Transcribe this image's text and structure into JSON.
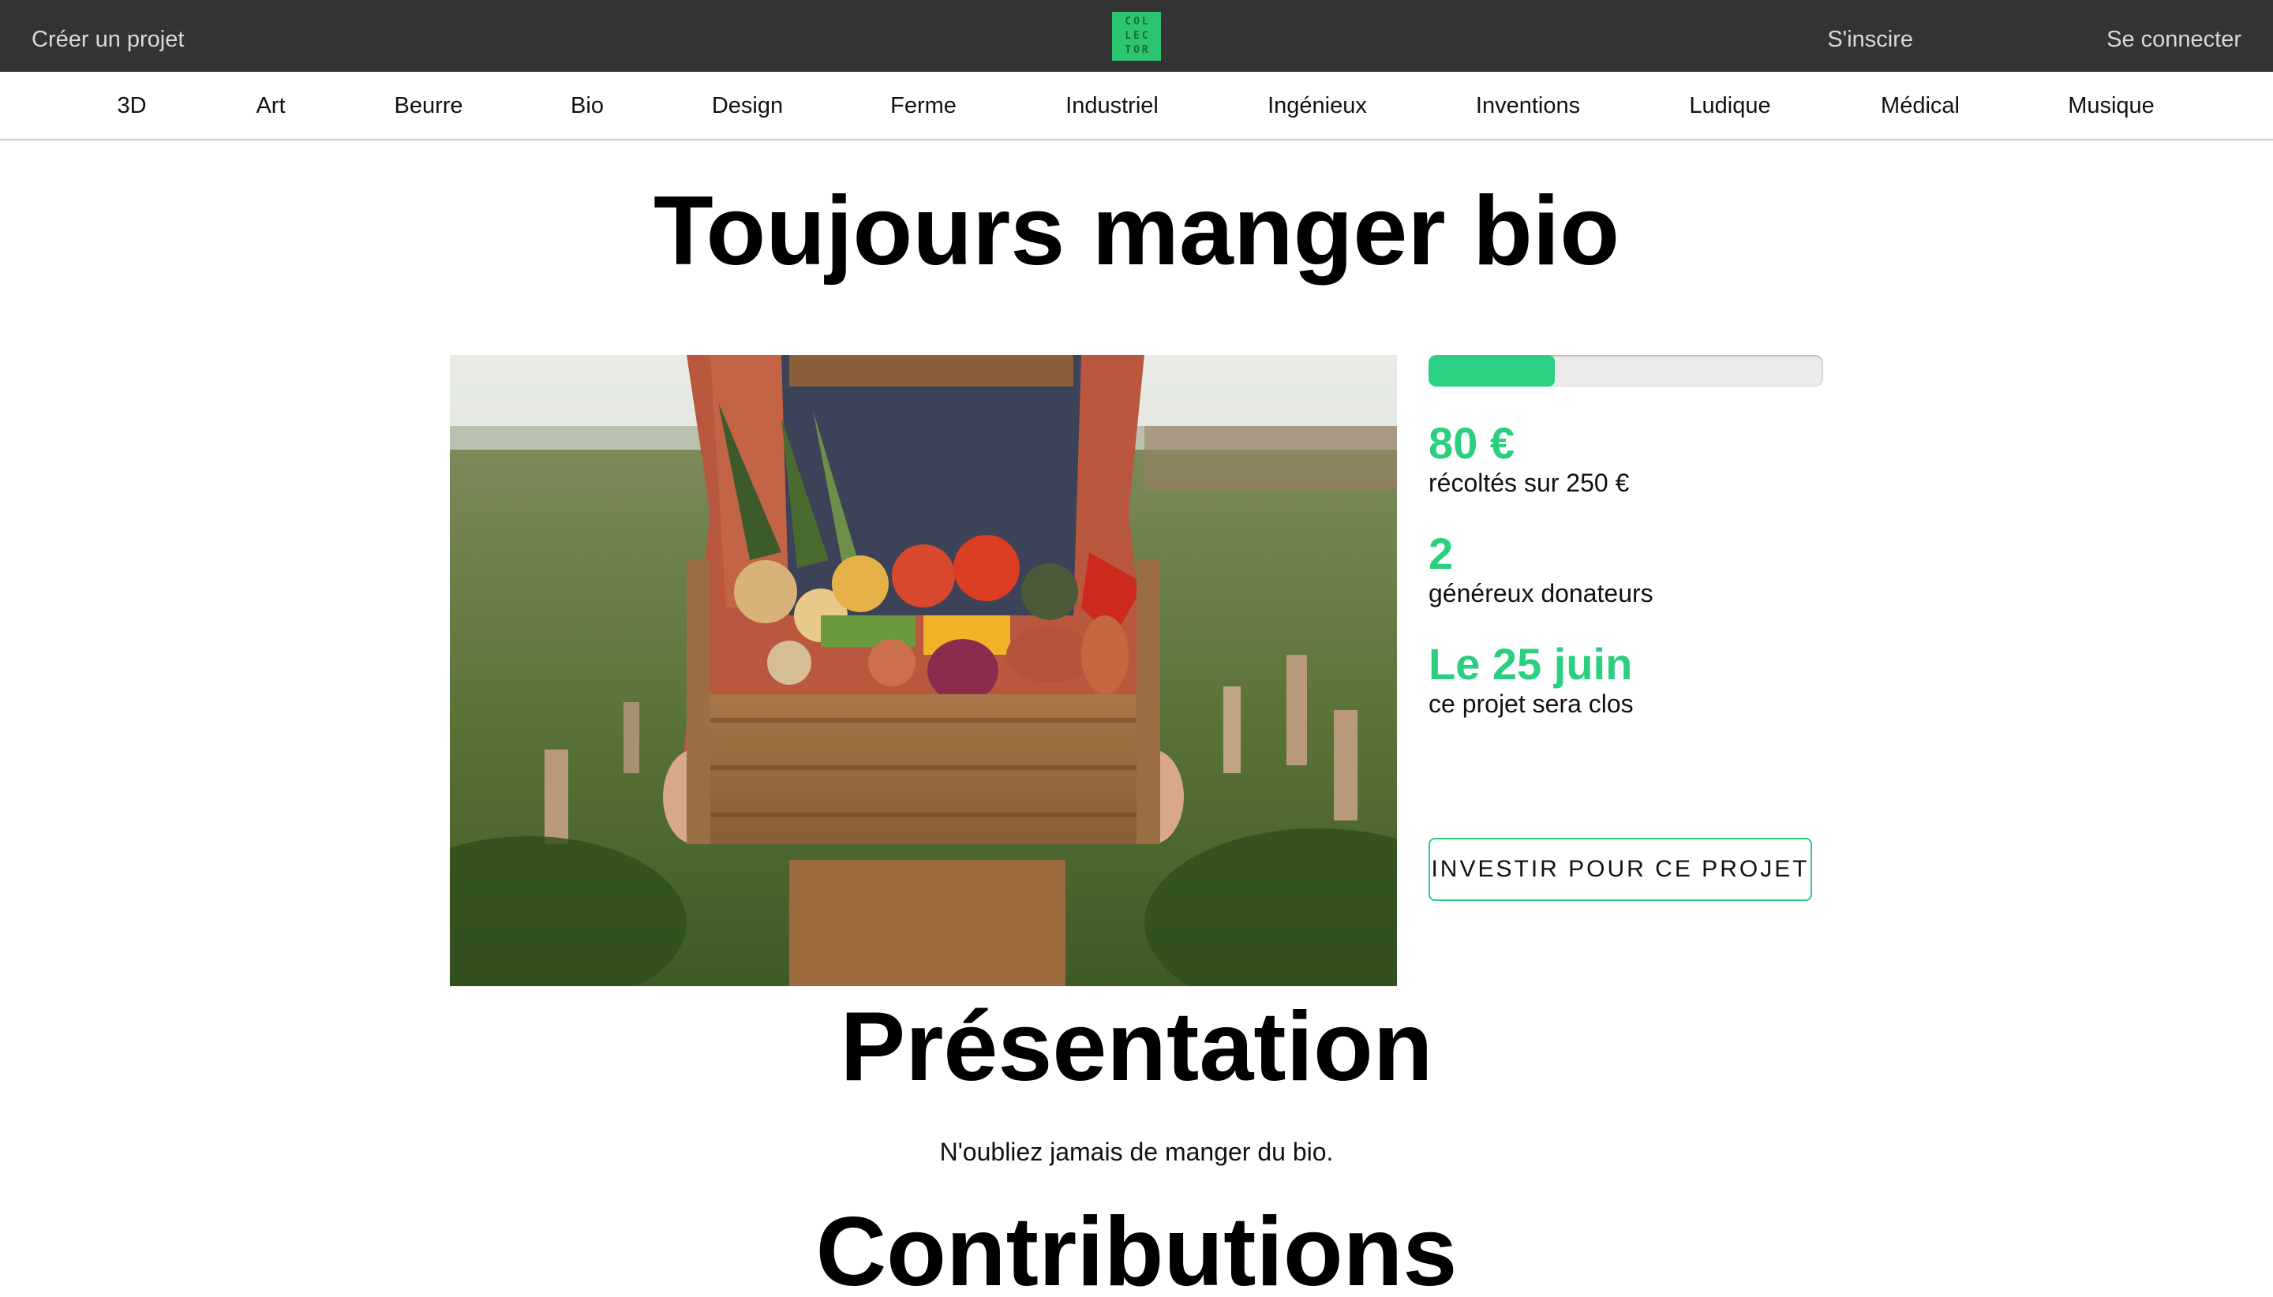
{
  "header": {
    "create_project": "Créer un projet",
    "logo_lines": [
      "COL",
      "LEC",
      "TOR"
    ],
    "signup": "S'inscire",
    "login": "Se connecter"
  },
  "categories": [
    "3D",
    "Art",
    "Beurre",
    "Bio",
    "Design",
    "Ferme",
    "Industriel",
    "Ingénieux",
    "Inventions",
    "Ludique",
    "Médical",
    "Musique"
  ],
  "project": {
    "title": "Toujours manger bio",
    "image_alt": "farmer holding crate of vegetables",
    "progress_fraction": 0.32,
    "raised_value": "80 €",
    "raised_label": "récoltés sur 250 €",
    "donors_value": "2",
    "donors_label": "généreux donateurs",
    "close_value": "Le 25 juin",
    "close_label": "ce projet sera clos",
    "invest_button": "INVESTIR POUR CE PROJET"
  },
  "presentation": {
    "title": "Présentation",
    "text": "N'oubliez jamais de manger du bio."
  },
  "contributions": {
    "title": "Contributions"
  },
  "colors": {
    "topbar": "#333333",
    "accent": "#2ad07f",
    "logo": "#2cc56f"
  }
}
